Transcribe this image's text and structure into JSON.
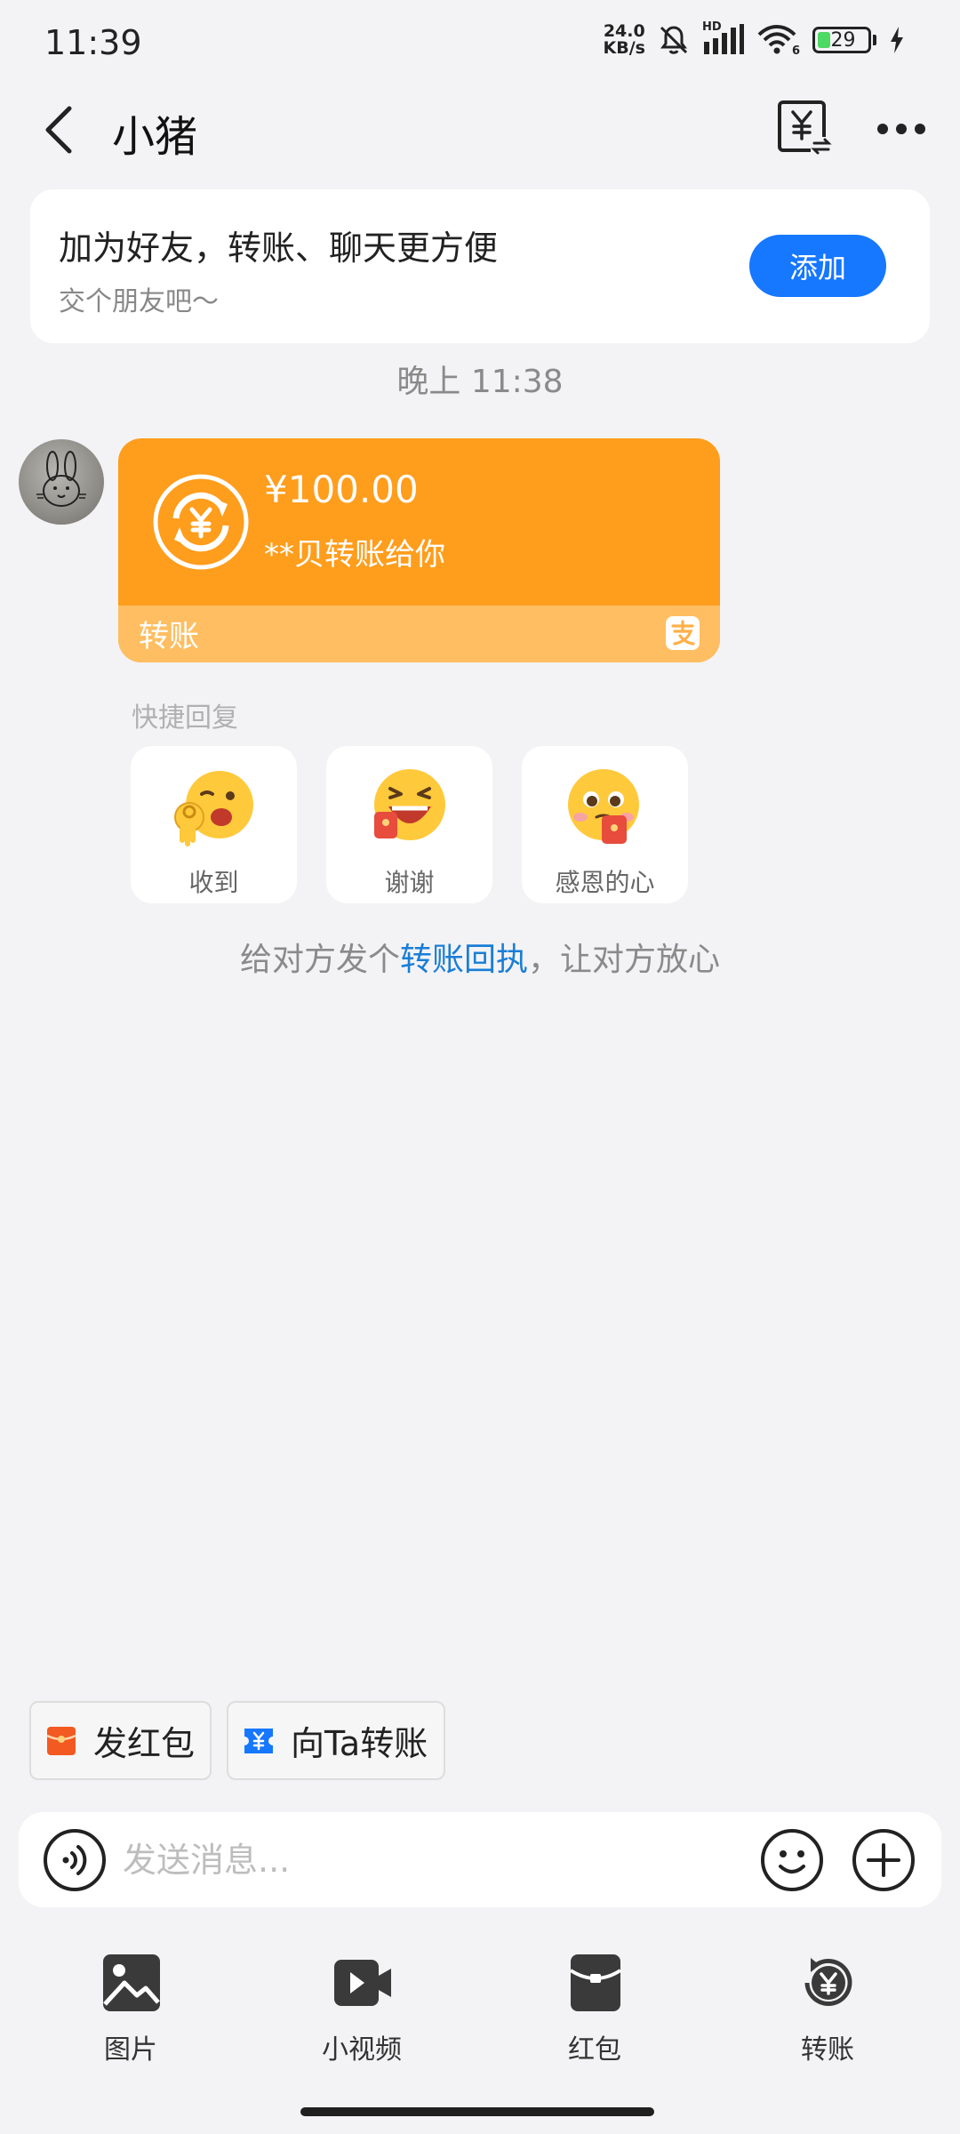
{
  "status_bar": {
    "time": "11:39",
    "net_speed_value": "24.0",
    "net_speed_unit": "KB/s",
    "network": "HD",
    "wifi_badge": "6",
    "battery": "29"
  },
  "header": {
    "title": "小猪",
    "icons": [
      "back-icon",
      "transfer-record-icon",
      "more-icon"
    ]
  },
  "friend_banner": {
    "title": "加为好友，转账、聊天更方便",
    "subtitle": "交个朋友吧～",
    "add_label": "添加"
  },
  "chat": {
    "timestamp": "晚上 11:38",
    "transfer_card": {
      "amount": "¥100.00",
      "description": "**贝转账给你",
      "type_label": "转账",
      "accent_color": "#ff9d1c"
    },
    "quick_reply": {
      "label": "快捷回复",
      "options": [
        {
          "label": "收到"
        },
        {
          "label": "谢谢"
        },
        {
          "label": "感恩的心"
        }
      ]
    },
    "receipt_hint": {
      "before": "给对方发个",
      "link": "转账回执",
      "after": "，让对方放心"
    }
  },
  "shortcuts": {
    "red_packet": "发红包",
    "transfer": "向Ta转账"
  },
  "input": {
    "placeholder": "发送消息..."
  },
  "toolbar": {
    "items": [
      {
        "label": "图片",
        "icon": "image-icon"
      },
      {
        "label": "小视频",
        "icon": "video-icon"
      },
      {
        "label": "红包",
        "icon": "red-packet-icon"
      },
      {
        "label": "转账",
        "icon": "transfer-icon"
      }
    ]
  },
  "colors": {
    "brand_blue": "#1677ff",
    "link_blue": "#1a7ed6",
    "transfer_orange": "#ff9d1c",
    "red_packet": "#f25a22"
  }
}
